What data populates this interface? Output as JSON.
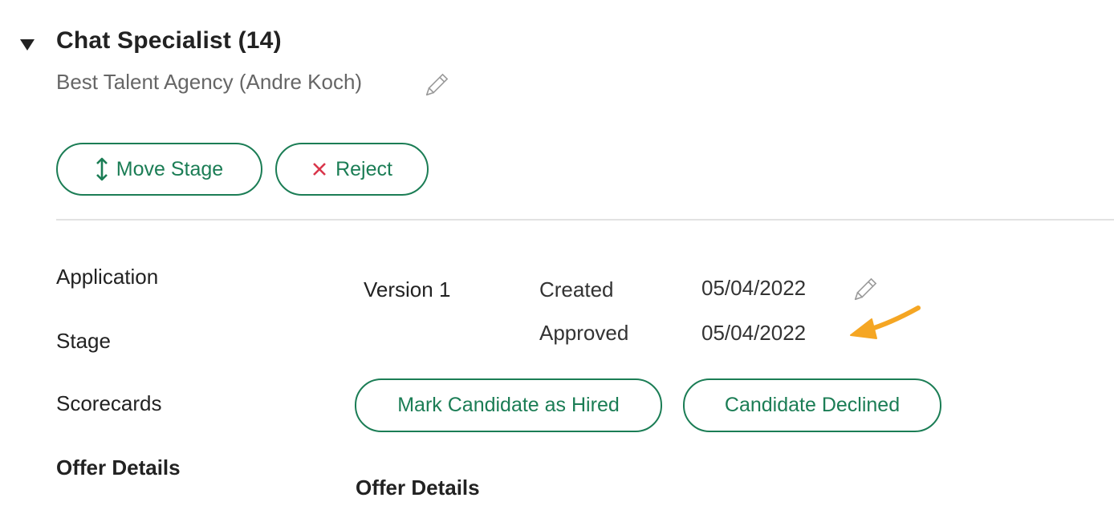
{
  "job": {
    "title": "Chat Specialist (14)",
    "agency": "Best Talent Agency (Andre Koch)",
    "toggle_icon": "caret-down-icon",
    "edit_icon": "pencil-icon"
  },
  "actions": {
    "move_stage": {
      "label": "Move Stage",
      "icon": "vertical-arrows-icon",
      "color": "#1b7d55"
    },
    "reject": {
      "label": "Reject",
      "icon": "close-icon",
      "icon_color": "#d9364a"
    }
  },
  "sidebar": {
    "items": [
      {
        "label": "Application",
        "active": false
      },
      {
        "label": "Stage",
        "active": false
      },
      {
        "label": "Scorecards",
        "active": false
      },
      {
        "label": "Offer Details",
        "active": true
      }
    ]
  },
  "offer": {
    "version": "Version 1",
    "created_label": "Created",
    "created_value": "05/04/2022",
    "approved_label": "Approved",
    "approved_value": "05/04/2022",
    "mark_hired_label": "Mark Candidate as Hired",
    "declined_label": "Candidate Declined",
    "section_heading": "Offer Details"
  },
  "annotation": {
    "icon": "arrow-annotation-icon",
    "color": "#f5a623"
  }
}
